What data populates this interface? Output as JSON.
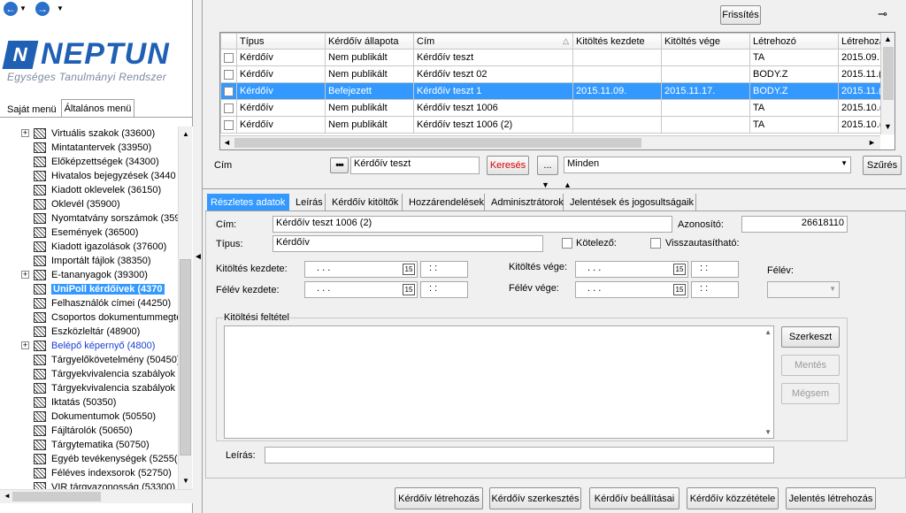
{
  "nav": {
    "back_icon": "back-arrow-icon",
    "forward_icon": "forward-arrow-icon"
  },
  "logo": {
    "name": "NEPTUN",
    "tagline": "Egységes Tanulmányi Rendszer"
  },
  "menu_tabs": [
    "Saját menü",
    "Általános menü"
  ],
  "tree": [
    {
      "label": "Virtuális szakok (33600)",
      "expand": true
    },
    {
      "label": "Mintatantervek (33950)"
    },
    {
      "label": "Előképzettségek (34300)"
    },
    {
      "label": "Hivatalos bejegyzések (3440"
    },
    {
      "label": "Kiadott oklevelek (36150)"
    },
    {
      "label": "Oklevél (35900)"
    },
    {
      "label": "Nyomtatvány sorszámok (359"
    },
    {
      "label": "Események (36500)"
    },
    {
      "label": "Kiadott igazolások (37600)"
    },
    {
      "label": "Importált fájlok (38350)"
    },
    {
      "label": "E-tananyagok (39300)",
      "expand": true
    },
    {
      "label": "UniPoll kérdőívek (4370",
      "selected": true
    },
    {
      "label": "Felhasználók címei (44250)"
    },
    {
      "label": "Csoportos dokumentummegte"
    },
    {
      "label": "Eszközleltár (48900)"
    },
    {
      "label": "Belépő képernyő (4800)",
      "expand": true,
      "link": true
    },
    {
      "label": "Tárgyelőkövetelmény (50450)"
    },
    {
      "label": "Tárgyekvivalencia szabályok"
    },
    {
      "label": "Tárgyekvivalencia szabályok"
    },
    {
      "label": "Iktatás (50350)"
    },
    {
      "label": "Dokumentumok (50550)"
    },
    {
      "label": "Fájltárolók (50650)"
    },
    {
      "label": "Tárgytematika (50750)"
    },
    {
      "label": "Egyéb tevékenységek (5255("
    },
    {
      "label": "Féléves indexsorok (52750)"
    },
    {
      "label": "VIR tárgyazonosság (53300)"
    }
  ],
  "toolbar": {
    "refresh": "Frissítés",
    "pin_icon": "pin-icon"
  },
  "grid": {
    "columns": [
      "",
      "Típus",
      "Kérdőív állapota",
      "Cím",
      "Kitöltés kezdete",
      "Kitöltés vége",
      "Létrehozó",
      "Létrehoza"
    ],
    "rows": [
      [
        "Kérdőív",
        "Nem publikált",
        "Kérdőív teszt",
        "",
        "",
        "TA",
        "2015.09."
      ],
      [
        "Kérdőív",
        "Nem publikált",
        "Kérdőív teszt 02",
        "",
        "",
        "BODY.Z",
        "2015.11.("
      ],
      [
        "Kérdőív",
        "Befejezett",
        "Kérdőív teszt 1",
        "2015.11.09.",
        "2015.11.17.",
        "BODY.Z",
        "2015.11.("
      ],
      [
        "Kérdőív",
        "Nem publikált",
        "Kérdőív teszt 1006",
        "",
        "",
        "TA",
        "2015.10.("
      ],
      [
        "Kérdőív",
        "Nem publikált",
        "Kérdőív teszt 1006 (2)",
        "",
        "",
        "TA",
        "2015.10.("
      ]
    ],
    "selected_row": 2
  },
  "search": {
    "label": "Cím",
    "value": "Kérdőív teszt",
    "search_btn": "Keresés",
    "ellipsis": "...",
    "filter_value": "Minden",
    "filter_btn": "Szűrés"
  },
  "tabs": [
    "Részletes adatok",
    "Leírás",
    "Kérdőív kitöltők",
    "Hozzárendelések",
    "Adminisztrátorok",
    "Jelentések és jogosultságaik"
  ],
  "detail": {
    "cim_label": "Cím:",
    "cim_value": "Kérdőív teszt 1006 (2)",
    "azon_label": "Azonosító:",
    "azon_value": "26618110",
    "tipus_label": "Típus:",
    "tipus_value": "Kérdőív",
    "kotelezo": "Kötelező:",
    "visszautasithato": "Visszautasítható:",
    "kitoltes_kezdete": "Kitöltés kezdete:",
    "kitoltes_vege": "Kitöltés vége:",
    "felev_kezdete": "Félév kezdete:",
    "felev_vege": "Félév vége:",
    "felev": "Félév:",
    "date_mask": ". . .",
    "time_mask": ": :",
    "cal_text": "15",
    "feltetel_label": "Kitöltési feltétel",
    "leiras_label": "Leírás:",
    "szerkeszt": "Szerkeszt",
    "mentes": "Mentés",
    "megsem": "Mégsem"
  },
  "bottom_buttons": [
    "Kérdőív létrehozás",
    "Kérdőív szerkesztés",
    "Kérdőív beállításai",
    "Kérdőív közzététele",
    "Jelentés létrehozás"
  ]
}
